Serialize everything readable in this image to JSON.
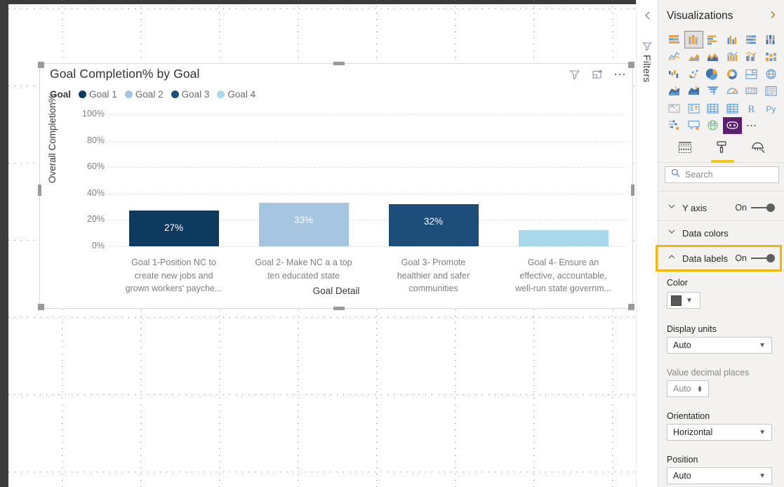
{
  "visual": {
    "title": "Goal Completion% by Goal",
    "actions": [
      {
        "name": "filter-icon",
        "label": "Filters"
      },
      {
        "name": "focus-mode-icon",
        "label": "Focus mode"
      },
      {
        "name": "more-options-icon",
        "label": "..."
      }
    ],
    "legend_title": "Goal",
    "legend": [
      {
        "label": "Goal 1",
        "color": "#0f3a60"
      },
      {
        "label": "Goal 2",
        "color": "#a5c5e0"
      },
      {
        "label": "Goal 3",
        "color": "#1d4e79"
      },
      {
        "label": "Goal 4",
        "color": "#a8d8ea"
      }
    ]
  },
  "chart_data": {
    "type": "bar",
    "title": "Goal Completion% by Goal",
    "xlabel": "Goal Detail",
    "ylabel": "Overall Completion%",
    "ylim": [
      0,
      100
    ],
    "ytick_labels": [
      "100%",
      "80%",
      "60%",
      "40%",
      "20%",
      "0%"
    ],
    "ytick_values": [
      100,
      80,
      60,
      40,
      20,
      0
    ],
    "grid": true,
    "legend_position": "top",
    "categories": [
      "Goal 1-Position NC to create new jobs and grown workers' payche...",
      "Goal 2- Make NC a a top ten educated state",
      "Goal 3- Promote healthier and safer communities",
      "Goal 4- Ensure an effective, accountable, well-run state governm..."
    ],
    "category_lines": [
      [
        "Goal 1-Position NC to",
        "create new jobs and",
        "grown workers' payche..."
      ],
      [
        "Goal 2- Make NC a a top",
        "ten educated state"
      ],
      [
        "Goal 3- Promote",
        "healthier and safer",
        "communities"
      ],
      [
        "Goal 4- Ensure an",
        "effective, accountable,",
        "well-run state governm..."
      ]
    ],
    "values": [
      27,
      33,
      32,
      12
    ],
    "data_labels": [
      "27%",
      "33%",
      "32%",
      ""
    ],
    "colors": [
      "#0f3a60",
      "#a5c5e0",
      "#1d4e79",
      "#a8d8ea"
    ],
    "series": [
      {
        "name": "Overall Completion%",
        "values": [
          27,
          33,
          32,
          12
        ]
      }
    ]
  },
  "filters_rail": {
    "collapse_label": "",
    "title": "Filters"
  },
  "vispane": {
    "title": "Visualizations",
    "icons": [
      "stacked-bar-chart-icon",
      "stacked-column-chart-icon",
      "clustered-bar-chart-icon",
      "clustered-column-chart-icon",
      "hundred-percent-stacked-bar-chart-icon",
      "hundred-percent-stacked-column-chart-icon",
      "line-chart-icon",
      "area-chart-icon",
      "stacked-area-chart-icon",
      "line-stacked-column-chart-icon",
      "line-clustered-column-chart-icon",
      "ribbon-chart-icon",
      "waterfall-chart-icon",
      "scatter-chart-icon",
      "pie-chart-icon",
      "donut-chart-icon",
      "treemap-icon",
      "map-icon",
      "filled-map-icon",
      "shape-map-icon",
      "funnel-chart-icon",
      "gauge-chart-icon",
      "card-icon",
      "multi-row-card-icon",
      "kpi-icon",
      "slicer-icon",
      "table-icon",
      "matrix-icon",
      "r-script-visual-icon",
      "python-visual-icon",
      "key-influencers-icon",
      "qna-visual-icon",
      "arcgis-map-icon",
      "custom-visual-icon",
      "more-visuals-icon"
    ],
    "selected_icon_index": 1,
    "tabs": [
      {
        "name": "fields-tab",
        "icon": "fields-table-icon",
        "active": false
      },
      {
        "name": "format-tab",
        "icon": "paint-roller-icon",
        "active": true
      },
      {
        "name": "analytics-tab",
        "icon": "magnifier-chart-icon",
        "active": false
      }
    ],
    "search_placeholder": "Search",
    "cards": [
      {
        "name": "y-axis",
        "label": "Y axis",
        "toggle": "On",
        "expanded": false,
        "highlighted": false
      },
      {
        "name": "data-colors",
        "label": "Data colors",
        "toggle": null,
        "expanded": false,
        "highlighted": false
      },
      {
        "name": "data-labels",
        "label": "Data labels",
        "toggle": "On",
        "expanded": true,
        "highlighted": true
      }
    ],
    "data_label_settings": {
      "color_label": "Color",
      "color_value": "#585858",
      "display_units_label": "Display units",
      "display_units_value": "Auto",
      "value_decimal_label": "Value decimal places",
      "value_decimal_value": "Auto",
      "orientation_label": "Orientation",
      "orientation_value": "Horizontal",
      "position_label": "Position",
      "position_value": "Auto"
    },
    "highlight_color": "#f2b705",
    "accent_color": "#f2c811"
  }
}
